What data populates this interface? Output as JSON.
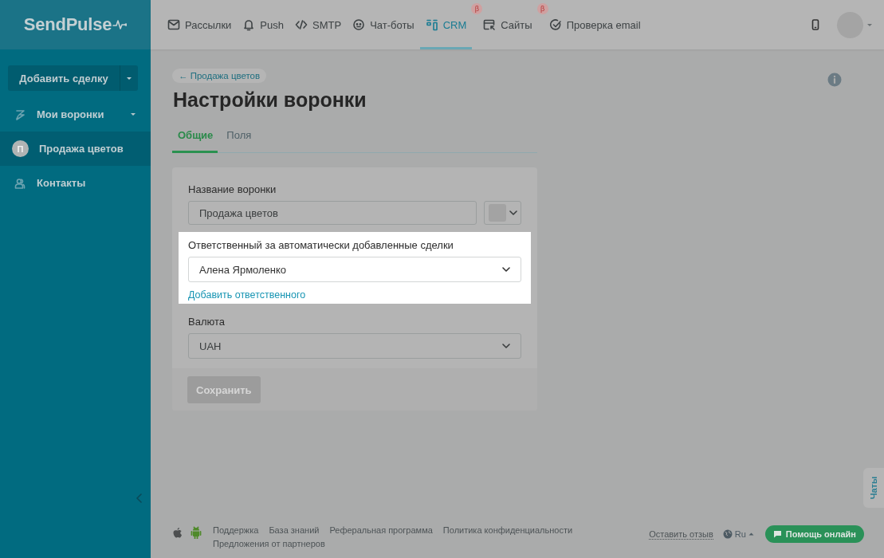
{
  "logo": "SendPulse",
  "sidebar": {
    "add_button": {
      "label": "Добавить сделку"
    },
    "items": [
      {
        "kind": "group",
        "label": "Мои воронки",
        "selected": false
      },
      {
        "kind": "pipeline",
        "label": "Продажа цветов",
        "initial": "П",
        "selected": true
      },
      {
        "kind": "contacts",
        "label": "Контакты",
        "selected": false
      }
    ]
  },
  "nav": [
    {
      "label": "Рассылки",
      "selected": false
    },
    {
      "label": "Push",
      "selected": false
    },
    {
      "label": "SMTP",
      "selected": false
    },
    {
      "label": "Чат-боты",
      "selected": false
    },
    {
      "label": "CRM",
      "selected": true,
      "beta": "β"
    },
    {
      "label": "Сайты",
      "selected": false,
      "beta": "β"
    },
    {
      "label": "Проверка email",
      "selected": false
    }
  ],
  "breadcrumb": "← Продажа цветов",
  "title": "Настройки воронки",
  "tabs": [
    {
      "label": "Общие",
      "selected": true
    },
    {
      "label": "Поля",
      "selected": false
    }
  ],
  "form": {
    "name_label": "Название воронки",
    "name_value": "Продажа цветов",
    "owner_label": "Ответственный за автоматически добавленные сделки",
    "owner_value": "Алена Ярмоленко",
    "add_owner_link": "Добавить ответственного",
    "currency_label": "Валюта",
    "currency_value": "UAH",
    "save_button": {
      "label": "Сохранить",
      "disabled": true
    }
  },
  "chat_tab": "Чаты",
  "footer": {
    "links": [
      "Поддержка",
      "База знаний",
      "Реферальная программа",
      "Политика конфиденциальности",
      "Предложения от партнеров"
    ],
    "feedback": "Оставить отзыв",
    "language": "Ru",
    "help_button": "Помощь онлайн"
  }
}
